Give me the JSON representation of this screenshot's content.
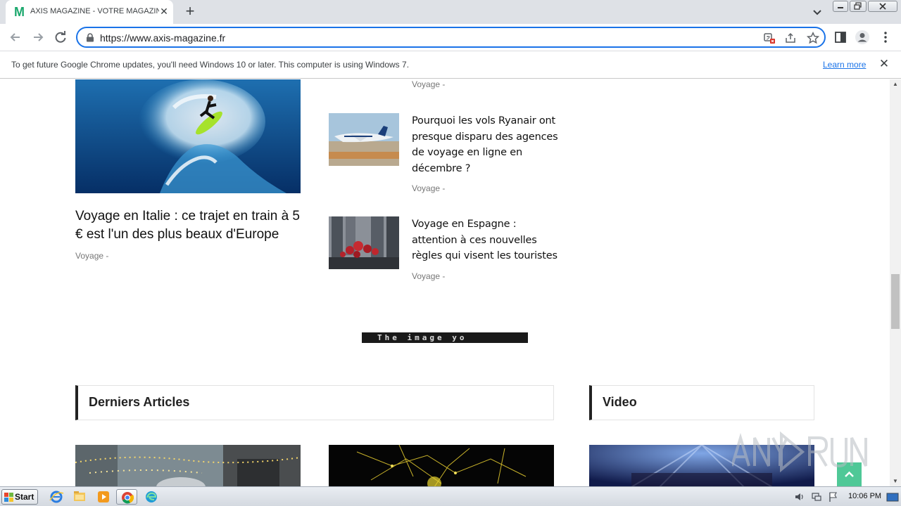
{
  "browser": {
    "tab_title": "AXIS MAGAZINE - VOTRE MAGAZINE",
    "tab_favicon_letter": "M",
    "new_tab_symbol": "+",
    "close_symbol": "✕",
    "url": "https://www.axis-magazine.fr"
  },
  "infobar": {
    "message": "To get future Google Chrome updates, you'll need Windows 10 or later. This computer is using Windows 7.",
    "link": "Learn more",
    "close_symbol": "✕"
  },
  "page": {
    "top_cut_category": "Voyage -",
    "feature": {
      "title": "Voyage en Italie : ce trajet en train à 5 € est l'un des plus beaux d'Europe",
      "category": "Voyage -"
    },
    "side_articles": [
      {
        "title": "Pourquoi les vols Ryanair ont presque disparu des agences de voyage en ligne en décembre ?",
        "category": "Voyage -"
      },
      {
        "title": "Voyage en Espagne : attention à ces nouvelles règles qui visent les touristes",
        "category": "Voyage -"
      }
    ],
    "ad_text": "The image yo",
    "sections": [
      {
        "title": "Derniers Articles"
      },
      {
        "title": "Video"
      }
    ]
  },
  "taskbar": {
    "start_label": "Start",
    "clock": "10:06 PM"
  },
  "colors": {
    "accent": "#1a73e8",
    "brand_green": "#1ba86d",
    "back_to_top": "#4fc897"
  }
}
